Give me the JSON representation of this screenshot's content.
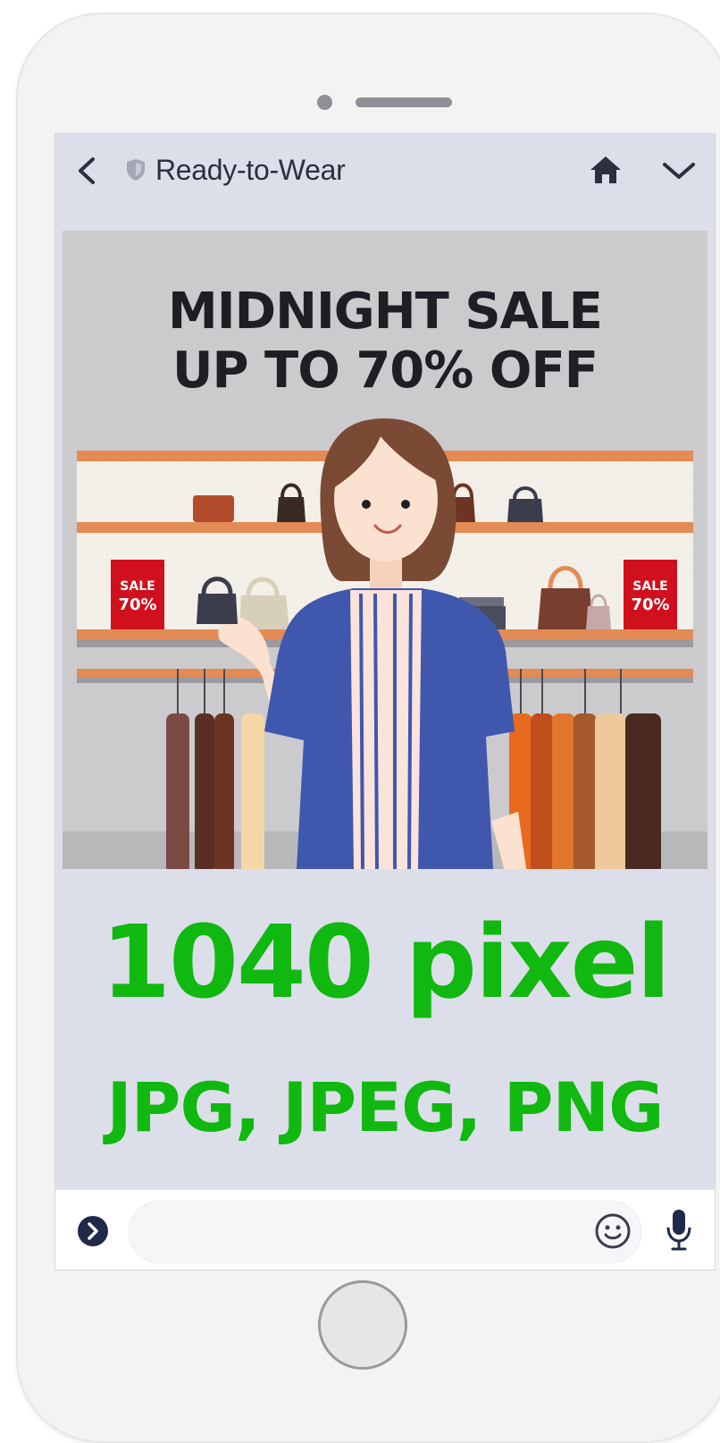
{
  "header": {
    "title": "Ready-to-Wear"
  },
  "banner": {
    "headline": "MIDNIGHT SALE",
    "subheadline": "UP TO 70% OFF",
    "sale_tag_left": {
      "line1": "SALE",
      "line2": "70%"
    },
    "sale_tag_right": {
      "line1": "SALE",
      "line2": "70%"
    }
  },
  "overlay": {
    "size_text": "1040 pixel",
    "formats_text": "JPG, JPEG, PNG"
  },
  "input": {
    "placeholder": ""
  },
  "colors": {
    "overlay_text": "#10b810",
    "screen_bg": "#dcdee9",
    "banner_bg": "#cbcbcd",
    "sale_tag": "#d0101c",
    "shelf": "#e48a55",
    "jacket": "#3f58ae"
  },
  "icons": [
    "back-icon",
    "shield-icon",
    "home-icon",
    "chevron-down-icon",
    "menu-toggle-icon",
    "emoji-icon",
    "mic-icon"
  ]
}
